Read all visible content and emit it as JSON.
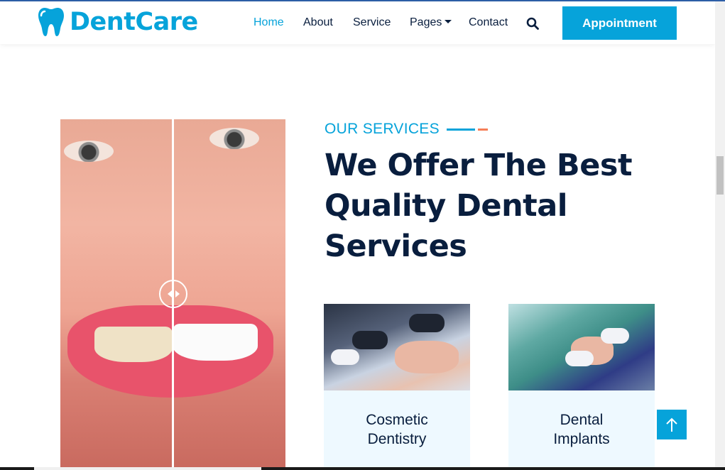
{
  "brand": {
    "name": "DentCare",
    "color": "#06a3da"
  },
  "nav": {
    "items": [
      {
        "label": "Home",
        "active": true
      },
      {
        "label": "About",
        "active": false
      },
      {
        "label": "Service",
        "active": false
      },
      {
        "label": "Pages",
        "active": false,
        "dropdown": true
      },
      {
        "label": "Contact",
        "active": false
      }
    ],
    "search_icon": "search-icon",
    "appointment_label": "Appointment"
  },
  "section": {
    "eyebrow": "OUR SERVICES",
    "heading_lines": [
      "We Offer The Best",
      "Quality Dental",
      "Services"
    ]
  },
  "image_compare": {
    "handle_icon": "left-right-arrows-icon"
  },
  "cards": [
    {
      "title_lines": [
        "Cosmetic",
        "Dentistry"
      ]
    },
    {
      "title_lines": [
        "Dental",
        "Implants"
      ]
    }
  ],
  "back_to_top_icon": "arrow-up-icon",
  "colors": {
    "primary": "#06a3da",
    "dark": "#091e3e",
    "accent": "#f57e57",
    "card_bg": "#eef9ff"
  }
}
